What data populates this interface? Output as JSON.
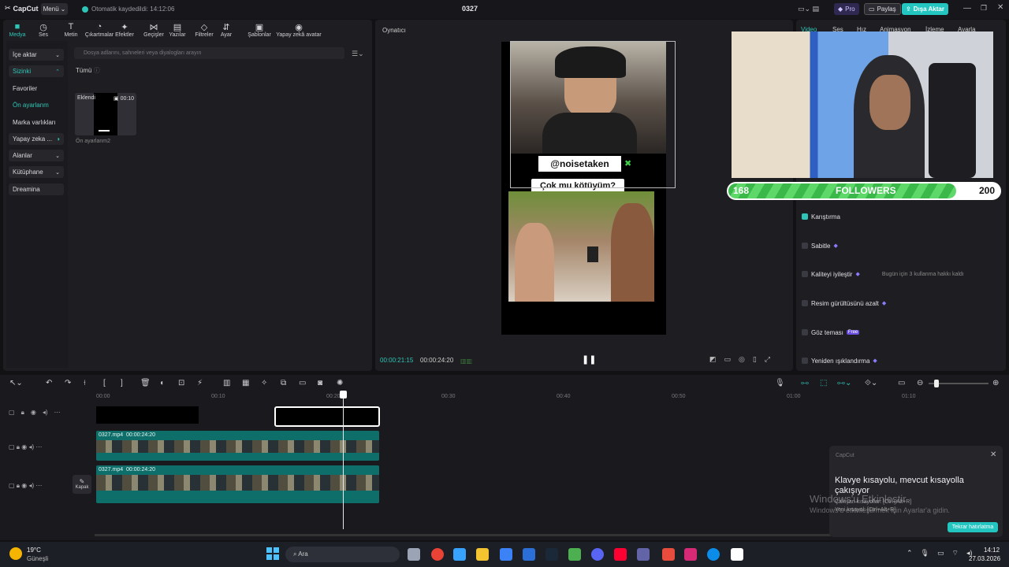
{
  "titlebar": {
    "logo": "CapCut",
    "menu": "Menü",
    "autosave": "Otomatik kaydedildi: 14:12:06",
    "title": "0327",
    "pro": "Pro",
    "share": "Paylaş",
    "export": "Dışa Aktar"
  },
  "tools": [
    {
      "label": "Medya",
      "icon": "■"
    },
    {
      "label": "Ses",
      "icon": "◷"
    },
    {
      "label": "Metin",
      "icon": "T"
    },
    {
      "label": "Çıkartmalar",
      "icon": "◔"
    },
    {
      "label": "Efektler",
      "icon": "✦"
    },
    {
      "label": "Geçişler",
      "icon": "⋈"
    },
    {
      "label": "Yazılar",
      "icon": "▤"
    },
    {
      "label": "Filtreler",
      "icon": "◇"
    },
    {
      "label": "Ayar",
      "icon": "⇵"
    },
    {
      "label": "Şablonlar",
      "icon": "▣"
    },
    {
      "label": "Yapay zekâ avatar",
      "icon": "◉"
    }
  ],
  "sidebar": [
    "İçe aktar",
    "Sizinki",
    "Favoriler",
    "Ön ayarlanm",
    "Marka varlıkları",
    "Yapay zeka ...",
    "Alanlar",
    "Kütüphane",
    "Dreamina"
  ],
  "search": {
    "placeholder": "Dosya adlarını, sahneleri veya diyalogları arayın"
  },
  "media": {
    "filter": "Tümü",
    "badge": "Eklendi",
    "duration": "00:10",
    "name": "Ön ayarlanm2"
  },
  "player": {
    "title": "Oynatıcı",
    "current": "00:00:21:15",
    "total": "00:00:24:20",
    "handle": "@noisetaken",
    "question": "Çok mu kötüyüm?"
  },
  "inspector": {
    "tabs": [
      "Video",
      "Ses",
      "Hız",
      "Animasyon",
      "İzleme",
      "Ayarla"
    ],
    "rows": [
      {
        "label": "Karıştırma",
        "note": ""
      },
      {
        "label": "Sabitle",
        "note": ""
      },
      {
        "label": "Kaliteyi iyileştir",
        "note": "Bugün için 3 kullanma hakkı kaldı"
      },
      {
        "label": "Resim gürültüsünü azalt",
        "note": ""
      },
      {
        "label": "Göz teması",
        "note": "Free"
      },
      {
        "label": "Yeniden ışıklandırma",
        "note": ""
      }
    ]
  },
  "overlay": {
    "followers_label": "FOLLOWERS",
    "current": "168",
    "goal": "200",
    "progress": 0.84
  },
  "timeline": {
    "ticks": [
      "00:00",
      "00:10",
      "00:20",
      "00:30",
      "00:40",
      "00:50",
      "01:00",
      "01:10"
    ],
    "clip1": {
      "name": "0327.mp4",
      "duration": "00:00:24:20"
    },
    "clip2": {
      "name": "0327.mp4",
      "duration": "00:00:24:20"
    },
    "cover": "Kapak"
  },
  "toast": {
    "app": "CapCut",
    "message": "Klavye kısayolu, mevcut kısayolla çakışıyor",
    "sub1": "Çakışan kısayollar: [Ctrl+Alt+R]",
    "sub2": "Yeni kısayol: [Ctrl+Alt+R]",
    "button": "Tekrar hatırlatma"
  },
  "watermark": {
    "line1": "Windows'u Etkinleştir",
    "line2": "Windows'u etkinleştirmek için Ayarlar'a gidin."
  },
  "taskbar": {
    "temp": "19°C",
    "weather": "Güneşli",
    "search": "Ara",
    "time": "14:12",
    "date": "27.03.2026"
  }
}
